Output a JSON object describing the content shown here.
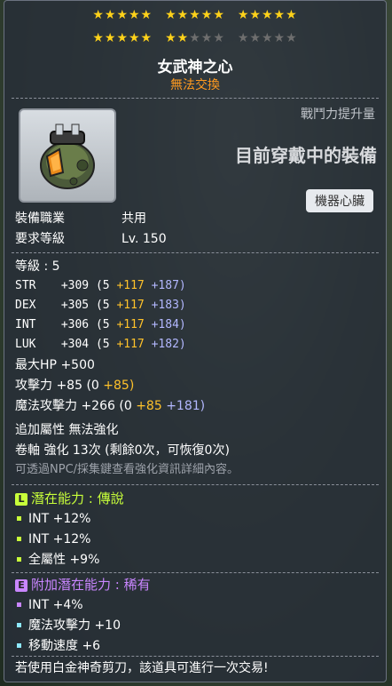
{
  "stars": {
    "row1": [
      "★★★★★",
      "★★★★★",
      "★★★★★"
    ],
    "row2_on": [
      "★★★★★",
      "★★"
    ],
    "row2_off": [
      "★★★",
      "★★★★★"
    ]
  },
  "item": {
    "name": "女武神之心",
    "trade": "無法交換",
    "power_label": "戰鬥力提升量",
    "equipped_label": "目前穿戴中的裝備",
    "category": "機器心臟",
    "icon": "mechanical-heart-icon"
  },
  "req": {
    "job_label": "裝備職業",
    "job_value": "共用",
    "level_label": "要求等級",
    "level_value": "Lv. 150"
  },
  "level_line": "等級 : 5",
  "stats": [
    {
      "name": "STR",
      "total": "+309",
      "base": "(5",
      "star": "+117",
      "extra": "+187)"
    },
    {
      "name": "DEX",
      "total": "+305",
      "base": "(5",
      "star": "+117",
      "extra": "+183)"
    },
    {
      "name": "INT",
      "total": "+306",
      "base": "(5",
      "star": "+117",
      "extra": "+184)"
    },
    {
      "name": "LUK",
      "total": "+304",
      "base": "(5",
      "star": "+117",
      "extra": "+182)"
    }
  ],
  "hp": {
    "label": "最大HP",
    "value": "+500"
  },
  "atk": {
    "label": "攻擊力",
    "total": "+85",
    "base": "(0",
    "star": "+85)"
  },
  "matk": {
    "label": "魔法攻擊力",
    "total": "+266",
    "base": "(0",
    "star": "+85",
    "extra": "+181)"
  },
  "extra_line": "追加屬性 無法強化",
  "scroll_line": "卷軸 強化 13次 (剩餘0次，可恢復0次)",
  "hint_line": "可透過NPC/採集鍵查看強化資訊詳細內容。",
  "potential": {
    "badge": "L",
    "title": "潛在能力 : 傳說",
    "color": "#c8ff3a",
    "lines": [
      "INT +12%",
      "INT +12%",
      "全屬性 +9%"
    ]
  },
  "bonus": {
    "badge": "E",
    "title": "附加潛在能力 : 稀有",
    "color": "#c986ff",
    "lines": [
      "INT +4%",
      "魔法攻擊力 +10",
      "移動速度 +6"
    ]
  },
  "footer": "若使用白金神奇剪刀，該道具可進行一次交易!"
}
